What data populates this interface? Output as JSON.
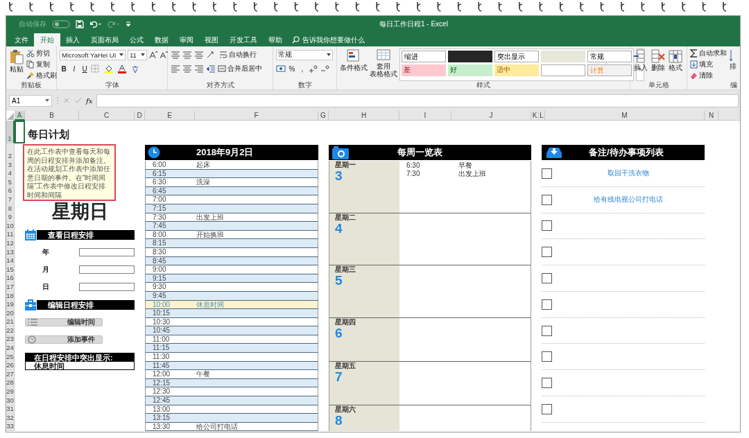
{
  "title_bar": {
    "autosave": {
      "label": "自动保存",
      "on": false
    },
    "title": "每日工作日程1 - Excel"
  },
  "tabs": [
    {
      "label": "文件",
      "selected": false
    },
    {
      "label": "开始",
      "selected": true
    },
    {
      "label": "插入",
      "selected": false
    },
    {
      "label": "页面布局",
      "selected": false
    },
    {
      "label": "公式",
      "selected": false
    },
    {
      "label": "数据",
      "selected": false
    },
    {
      "label": "审阅",
      "selected": false
    },
    {
      "label": "视图",
      "selected": false
    },
    {
      "label": "开发工具",
      "selected": false
    },
    {
      "label": "帮助",
      "selected": false
    }
  ],
  "tell_me": {
    "placeholder": "告诉我你想要做什么"
  },
  "ribbon": {
    "clipboard": {
      "paste": "粘贴",
      "items": [
        "剪切",
        "复制",
        "格式刷"
      ],
      "label": "剪贴板"
    },
    "font": {
      "font_name": "Microsoft YaHei UI",
      "font_size": "11",
      "styles": [
        "B",
        "I",
        "U"
      ],
      "label": "字体"
    },
    "alignment": {
      "wrap": "自动换行",
      "merge": "合并后居中",
      "label": "对齐方式"
    },
    "number": {
      "format": "常规",
      "symbols": [
        "%",
        ","
      ],
      "label": "数字"
    },
    "styles": {
      "buttons": [
        {
          "lines": [
            "条件格式"
          ]
        },
        {
          "lines": [
            "套用",
            "表格格式"
          ]
        }
      ],
      "gallery": [
        {
          "label": "缩进",
          "color": "#ffffff",
          "kind": "plain"
        },
        {
          "color": "#262626",
          "kind": "plain"
        },
        {
          "label": "突出显示",
          "color": "#ffffff",
          "kind": "plain"
        },
        {
          "color": "#e6e6d9",
          "kind": "plain"
        },
        {
          "label": "常规",
          "color": "#ffffff",
          "kind": "plain"
        },
        {
          "label": "差",
          "color": "#ffc7ce",
          "kind": "bad"
        },
        {
          "label": "好",
          "color": "#c6efce",
          "kind": "good"
        },
        {
          "label": "适中",
          "color": "#ffeb9c",
          "kind": "neutral"
        },
        {
          "color": "#ffffff",
          "kind": "plain"
        },
        {
          "label": "计算",
          "color": "#f2f2f2",
          "kind": "calculation"
        }
      ],
      "label": "样式"
    },
    "cells": {
      "buttons": [
        "插入",
        "删除",
        "格式"
      ],
      "label": "单元格"
    },
    "editing": {
      "items": [
        "自动求和",
        "填充",
        "清除"
      ],
      "sort": "排",
      "label": "编"
    }
  },
  "formula_bar": {
    "name_box": "A1",
    "function_label": "fx"
  },
  "sheet": {
    "columns": [
      {
        "label": "A",
        "selected": true
      },
      {
        "label": "B",
        "selected": false
      },
      {
        "label": "C",
        "selected": false
      },
      {
        "label": "D",
        "selected": false
      },
      {
        "label": "E",
        "selected": false
      },
      {
        "label": "F",
        "selected": false
      },
      {
        "label": "G",
        "selected": false
      },
      {
        "label": "H",
        "selected": false
      },
      {
        "label": "I",
        "selected": false
      },
      {
        "label": "J",
        "selected": false
      },
      {
        "label": "K",
        "selected": false
      },
      {
        "label": "L",
        "selected": false
      },
      {
        "label": "M",
        "selected": false
      },
      {
        "label": "N",
        "selected": false
      }
    ],
    "rows": [
      {
        "label": "1",
        "selected": true
      },
      {
        "label": "2",
        "selected": false
      },
      {
        "label": "3",
        "selected": false
      },
      {
        "label": "4",
        "selected": false
      },
      {
        "label": "5",
        "selected": false
      },
      {
        "label": "6",
        "selected": false
      },
      {
        "label": "7",
        "selected": false
      },
      {
        "label": "8",
        "selected": false
      },
      {
        "label": "9",
        "selected": false
      },
      {
        "label": "10",
        "selected": false
      },
      {
        "label": "11",
        "selected": false
      },
      {
        "label": "12",
        "selected": false
      },
      {
        "label": "13",
        "selected": false
      },
      {
        "label": "14",
        "selected": false
      },
      {
        "label": "15",
        "selected": false
      },
      {
        "label": "16",
        "selected": false
      },
      {
        "label": "17",
        "selected": false
      },
      {
        "label": "18",
        "selected": false
      },
      {
        "label": "19",
        "selected": false
      },
      {
        "label": "20",
        "selected": false
      },
      {
        "label": "21",
        "selected": false
      },
      {
        "label": "22",
        "selected": false
      },
      {
        "label": "23",
        "selected": false
      },
      {
        "label": "24",
        "selected": false
      },
      {
        "label": "25",
        "selected": false
      },
      {
        "label": "26",
        "selected": false
      },
      {
        "label": "27",
        "selected": false
      },
      {
        "label": "28",
        "selected": false
      },
      {
        "label": "29",
        "selected": false
      },
      {
        "label": "30",
        "selected": false
      },
      {
        "label": "31",
        "selected": false
      },
      {
        "label": "32",
        "selected": false
      },
      {
        "label": "33",
        "selected": false
      }
    ],
    "title": "每日计划",
    "comment": "在此工作表中查看每天和每周的日程安排并添加备注。在活动规划工作表中添加任意日期的事件。在“时间间隔”工作表中修改日程安排时间和间隔",
    "weekday": "星期日",
    "view_header": "查看日程安排",
    "fields": [
      {
        "label": "年"
      },
      {
        "label": "月"
      },
      {
        "label": "日"
      }
    ],
    "edit_header": "编辑日程安排",
    "buttons": [
      {
        "label": "编辑时间",
        "kind": "list"
      },
      {
        "label": "添加事件",
        "kind": "clock"
      }
    ],
    "highlight": {
      "title": "在日程安排中突出显示:",
      "value": "休息时间"
    }
  },
  "schedule": {
    "date": "2018年9月2日",
    "rows": [
      {
        "time": "6:00",
        "event": "起床",
        "highlighted": false
      },
      {
        "time": "6:15",
        "highlighted": false
      },
      {
        "time": "6:30",
        "event": "洗澡",
        "highlighted": false
      },
      {
        "time": "6:45",
        "highlighted": false
      },
      {
        "time": "7:00",
        "highlighted": false
      },
      {
        "time": "7:15",
        "highlighted": false
      },
      {
        "time": "7:30",
        "event": "出发上班",
        "highlighted": false
      },
      {
        "time": "7:45",
        "highlighted": false
      },
      {
        "time": "8:00",
        "event": "开始换班",
        "highlighted": false
      },
      {
        "time": "8:15",
        "highlighted": false
      },
      {
        "time": "8:30",
        "highlighted": false
      },
      {
        "time": "8:45",
        "highlighted": false
      },
      {
        "time": "9:00",
        "highlighted": false
      },
      {
        "time": "9:15",
        "highlighted": false
      },
      {
        "time": "9:30",
        "highlighted": false
      },
      {
        "time": "9:45",
        "highlighted": false
      },
      {
        "time": "10:00",
        "event": "休息时间",
        "highlighted": true
      },
      {
        "time": "10:15",
        "highlighted": false
      },
      {
        "time": "10:30",
        "highlighted": false
      },
      {
        "time": "10:45",
        "highlighted": false
      },
      {
        "time": "11:00",
        "highlighted": false
      },
      {
        "time": "11:15",
        "highlighted": false
      },
      {
        "time": "11:30",
        "highlighted": false
      },
      {
        "time": "11:45",
        "highlighted": false
      },
      {
        "time": "12:00",
        "event": "午餐",
        "highlighted": false
      },
      {
        "time": "12:15",
        "highlighted": false
      },
      {
        "time": "12:30",
        "highlighted": false
      },
      {
        "time": "12:45",
        "highlighted": false
      },
      {
        "time": "13:00",
        "highlighted": false
      },
      {
        "time": "13:15",
        "highlighted": false
      },
      {
        "time": "13:30",
        "event": "给公司打电话",
        "highlighted": false
      }
    ]
  },
  "weekly": {
    "title": "每周一览表",
    "days": [
      {
        "name": "星期一",
        "date": "3",
        "events": [
          {
            "time": "6:30",
            "text": "早餐"
          },
          {
            "time": "7:30",
            "text": "出发上班"
          }
        ]
      },
      {
        "name": "星期二",
        "date": "4"
      },
      {
        "name": "星期三",
        "date": "5"
      },
      {
        "name": "星期四",
        "date": "6"
      },
      {
        "name": "星期五",
        "date": "7"
      },
      {
        "name": "星期六",
        "date": "8"
      }
    ]
  },
  "todo": {
    "title": "备注/待办事项列表",
    "items": [
      {
        "text": "取回干洗衣物",
        "checked": false
      },
      {
        "text": "给有线电视公司打电话",
        "checked": false
      },
      {
        "checked": false
      },
      {
        "checked": false
      },
      {
        "checked": false
      },
      {
        "checked": false
      },
      {
        "checked": false
      },
      {
        "checked": false
      },
      {
        "checked": false
      },
      {
        "checked": false
      }
    ]
  }
}
